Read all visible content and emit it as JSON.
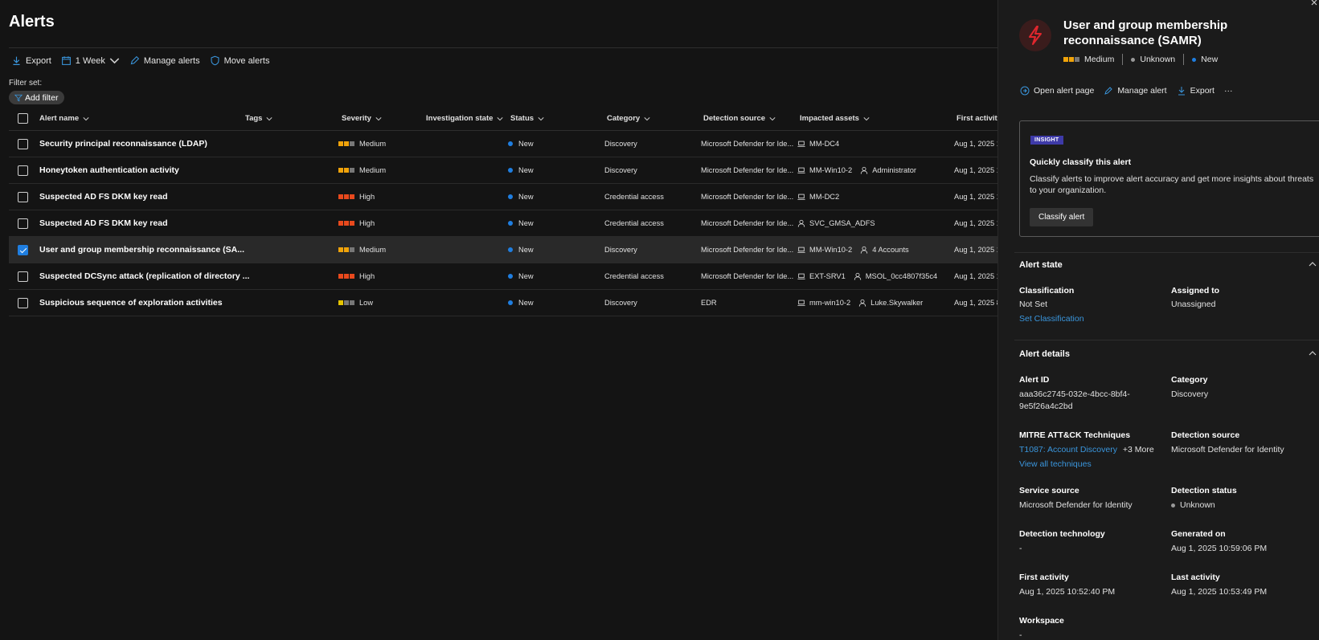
{
  "page": {
    "title": "Alerts"
  },
  "toolbar": {
    "export": "Export",
    "period": "1 Week",
    "manage_alerts": "Manage alerts",
    "move_alerts": "Move alerts"
  },
  "filters": {
    "filter_set_label": "Filter set:",
    "add_filter": "Add filter"
  },
  "table": {
    "headers": {
      "alert_name": "Alert name",
      "tags": "Tags",
      "severity": "Severity",
      "investigation_state": "Investigation state",
      "status": "Status",
      "category": "Category",
      "detection_source": "Detection source",
      "impacted_assets": "Impacted assets",
      "first_activity": "First activity"
    },
    "rows": [
      {
        "name": "Security principal reconnaissance (LDAP)",
        "severity": "Medium",
        "status": "New",
        "category": "Discovery",
        "source": "Microsoft Defender for Ide...",
        "device": "MM-DC4",
        "user": "",
        "first": "Aug 1, 2025 1"
      },
      {
        "name": "Honeytoken authentication activity",
        "severity": "Medium",
        "status": "New",
        "category": "Discovery",
        "source": "Microsoft Defender for Ide...",
        "device": "MM-Win10-2",
        "user": "Administrator",
        "first": "Aug 1, 2025 1"
      },
      {
        "name": "Suspected AD FS DKM key read",
        "severity": "High",
        "status": "New",
        "category": "Credential access",
        "source": "Microsoft Defender for Ide...",
        "device": "MM-DC2",
        "user": "",
        "first": "Aug 1, 2025 1"
      },
      {
        "name": "Suspected AD FS DKM key read",
        "severity": "High",
        "status": "New",
        "category": "Credential access",
        "source": "Microsoft Defender for Ide...",
        "device": "",
        "user": "SVC_GMSA_ADFS",
        "first": "Aug 1, 2025 1"
      },
      {
        "name": "User and group membership reconnaissance (SA...",
        "severity": "Medium",
        "status": "New",
        "category": "Discovery",
        "source": "Microsoft Defender for Ide...",
        "device": "MM-Win10-2",
        "user": "4 Accounts",
        "first": "Aug 1, 2025 1"
      },
      {
        "name": "Suspected DCSync attack (replication of directory ...",
        "severity": "High",
        "status": "New",
        "category": "Credential access",
        "source": "Microsoft Defender for Ide...",
        "device": "EXT-SRV1",
        "user": "MSOL_0cc4807f35c4",
        "first": "Aug 1, 2025 1"
      },
      {
        "name": "Suspicious sequence of exploration activities",
        "severity": "Low",
        "status": "New",
        "category": "Discovery",
        "source": "EDR",
        "device": "mm-win10-2",
        "user": "Luke.Skywalker",
        "first": "Aug 1, 2025 8"
      }
    ]
  },
  "panel": {
    "title": "User and group membership reconnaissance (SAMR)",
    "severity": "Medium",
    "detection_status": "Unknown",
    "status": "New",
    "actions": {
      "open": "Open alert page",
      "manage": "Manage alert",
      "export": "Export",
      "more": "···"
    },
    "insight": {
      "badge": "INSIGHT",
      "title": "Quickly classify this alert",
      "text": "Classify alerts to improve alert accuracy and get more insights about threats to your organization.",
      "button": "Classify alert"
    },
    "alert_state": {
      "heading": "Alert state",
      "classification_label": "Classification",
      "classification_value": "Not Set",
      "set_classification": "Set Classification",
      "assigned_label": "Assigned to",
      "assigned_value": "Unassigned"
    },
    "alert_details": {
      "heading": "Alert details",
      "alert_id_label": "Alert ID",
      "alert_id_line1": "aaa36c2745-032e-4bcc-8bf4-",
      "alert_id_line2": "9e5f26a4c2bd",
      "category_label": "Category",
      "category_value": "Discovery",
      "mitre_label": "MITRE ATT&CK Techniques",
      "mitre_link": "T1087: Account Discovery",
      "mitre_more": "+3 More",
      "view_all": "View all techniques",
      "detection_source_label": "Detection source",
      "detection_source_value": "Microsoft Defender for Identity",
      "service_source_label": "Service source",
      "service_source_value": "Microsoft Defender for Identity",
      "detection_status_label": "Detection status",
      "detection_status_value": "Unknown",
      "detection_tech_label": "Detection technology",
      "detection_tech_value": "-",
      "generated_label": "Generated on",
      "generated_value": "Aug 1, 2025 10:59:06 PM",
      "first_activity_label": "First activity",
      "first_activity_value": "Aug 1, 2025 10:52:40 PM",
      "last_activity_label": "Last activity",
      "last_activity_value": "Aug 1, 2025 10:53:49 PM",
      "workspace_label": "Workspace",
      "workspace_value": "-"
    }
  },
  "colors": {
    "accent": "#1f7ee0",
    "medium": "#f0a30a",
    "high": "#e8491d",
    "low": "#e5c400",
    "link": "#3a96dd"
  }
}
